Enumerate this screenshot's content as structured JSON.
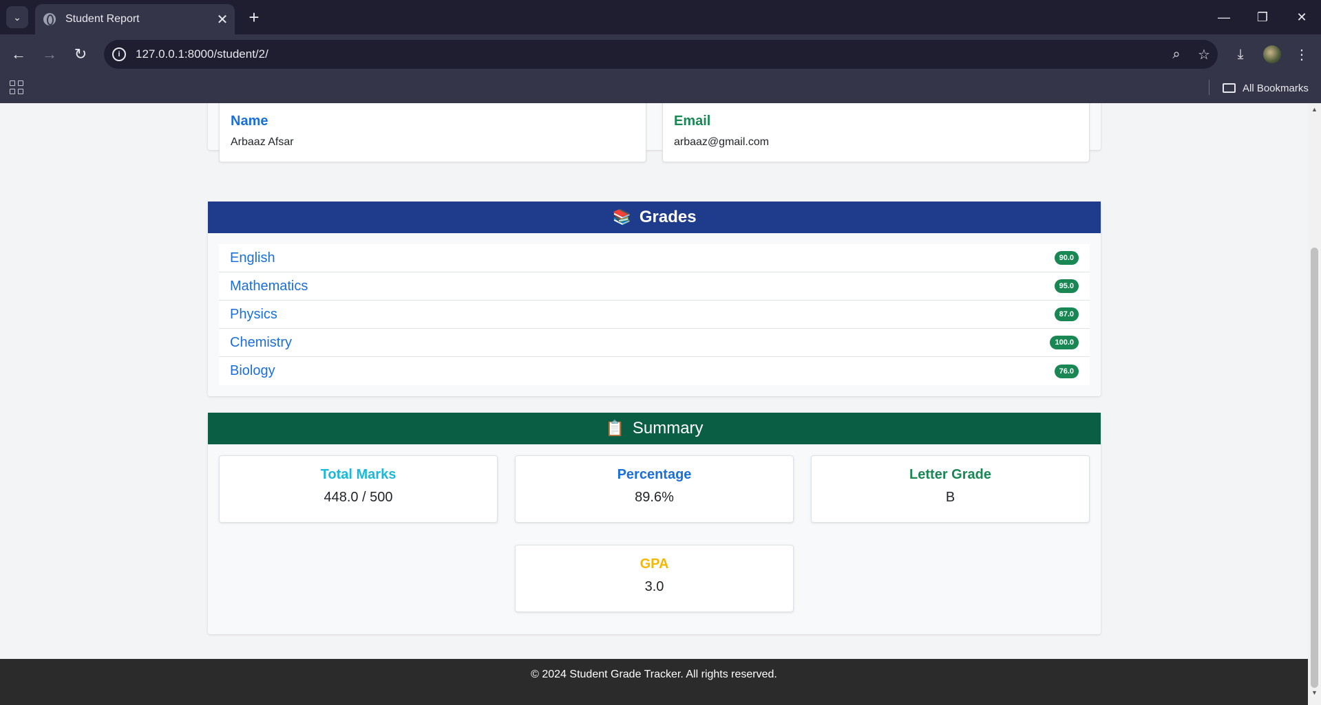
{
  "browser": {
    "tab_title": "Student Report",
    "url": "127.0.0.1:8000/student/2/",
    "bookmarks_label": "All Bookmarks"
  },
  "student": {
    "name_label": "Name",
    "name": "Arbaaz Afsar",
    "email_label": "Email",
    "email": "arbaaz@gmail.com"
  },
  "grades": {
    "title": "Grades",
    "items": [
      {
        "subject": "English",
        "score": "90.0"
      },
      {
        "subject": "Mathematics",
        "score": "95.0"
      },
      {
        "subject": "Physics",
        "score": "87.0"
      },
      {
        "subject": "Chemistry",
        "score": "100.0"
      },
      {
        "subject": "Biology",
        "score": "76.0"
      }
    ]
  },
  "summary": {
    "title": "Summary",
    "total_label": "Total Marks",
    "total_value": "448.0 / 500",
    "percentage_label": "Percentage",
    "percentage_value": "89.6%",
    "letter_label": "Letter Grade",
    "letter_value": "B",
    "gpa_label": "GPA",
    "gpa_value": "3.0"
  },
  "footer": {
    "text": "© 2024 Student Grade Tracker. All rights reserved."
  },
  "colors": {
    "grades_header": "#1f3b8c",
    "summary_header": "#0a5e43",
    "name_label": "#1a6fd8",
    "email_label": "#198754",
    "total_label": "#1bb8d9",
    "percentage_label": "#1a6fd8",
    "letter_label": "#198754",
    "gpa_label": "#f5b800",
    "badge": "#198754"
  },
  "icons": {
    "grades": "books-icon",
    "summary": "clipboard-icon"
  }
}
